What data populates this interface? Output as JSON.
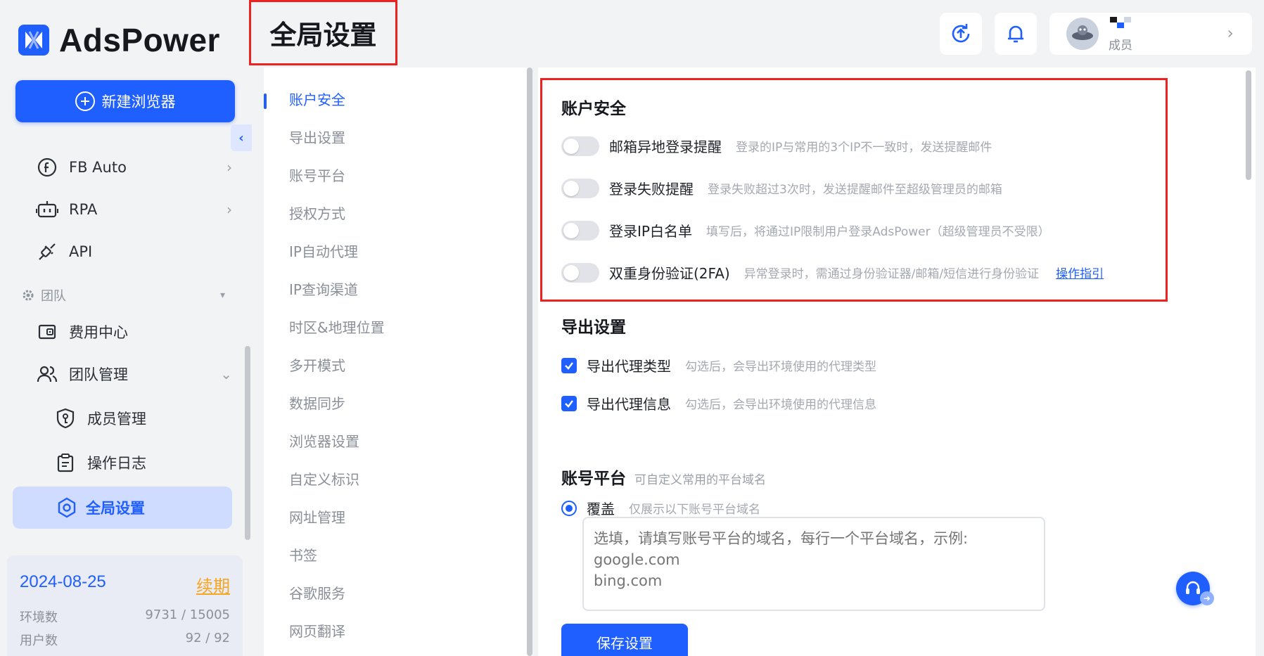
{
  "app": {
    "brand": "AdsPower",
    "page_title": "全局设置"
  },
  "sidebar": {
    "new_browser_label": "新建浏览器",
    "collapse_glyph": "‹",
    "items": [
      {
        "label": "FB Auto",
        "icon": "fb-auto-icon"
      },
      {
        "label": "RPA",
        "icon": "robot-icon"
      },
      {
        "label": "API",
        "icon": "api-plug-icon"
      }
    ],
    "team_section_label": "团队",
    "team_items": [
      {
        "label": "费用中心",
        "icon": "wallet-icon"
      },
      {
        "label": "团队管理",
        "icon": "team-icon"
      }
    ],
    "team_sub_items": [
      {
        "label": "成员管理",
        "icon": "shield-icon"
      },
      {
        "label": "操作日志",
        "icon": "clipboard-icon"
      },
      {
        "label": "全局设置",
        "icon": "settings-icon"
      }
    ],
    "plan": {
      "expiry_date": "2024-08-25",
      "renew_label": "续期",
      "env_label": "环境数",
      "env_value": "9731 / 15005",
      "user_label": "用户数",
      "user_value": "92 / 92"
    }
  },
  "header": {
    "user_role": "成员"
  },
  "settings_nav": {
    "items": [
      "账户安全",
      "导出设置",
      "账号平台",
      "授权方式",
      "IP自动代理",
      "IP查询渠道",
      "时区&地理位置",
      "多开模式",
      "数据同步",
      "浏览器设置",
      "自定义标识",
      "网址管理",
      "书签",
      "谷歌服务",
      "网页翻译"
    ],
    "active_index": 0
  },
  "account_security": {
    "title": "账户安全",
    "rows": [
      {
        "label": "邮箱异地登录提醒",
        "desc": "登录的IP与常用的3个IP不一致时，发送提醒邮件",
        "enabled": false
      },
      {
        "label": "登录失败提醒",
        "desc": "登录失败超过3次时，发送提醒邮件至超级管理员的邮箱",
        "enabled": false
      },
      {
        "label": "登录IP白名单",
        "desc": "填写后，将通过IP限制用户登录AdsPower（超级管理员不受限）",
        "enabled": false
      },
      {
        "label": "双重身份验证(2FA)",
        "desc": "异常登录时，需通过身份验证器/邮箱/短信进行身份验证",
        "link": "操作指引",
        "enabled": false
      }
    ]
  },
  "export_settings": {
    "title": "导出设置",
    "rows": [
      {
        "label": "导出代理类型",
        "desc": "勾选后，会导出环境使用的代理类型",
        "checked": true
      },
      {
        "label": "导出代理信息",
        "desc": "勾选后，会导出环境使用的代理信息",
        "checked": true
      }
    ]
  },
  "account_platform": {
    "title": "账号平台",
    "subtitle": "可自定义常用的平台域名",
    "radio_label": "覆盖",
    "radio_desc": "仅展示以下账号平台域名",
    "textarea_placeholder": "选填，请填写账号平台的域名，每行一个平台域名，示例:\ngoogle.com\nbing.com"
  },
  "actions": {
    "save_label": "保存设置"
  },
  "colors": {
    "accent": "#1f5eff",
    "highlight": "#ee2121",
    "renew": "#f5a623"
  }
}
